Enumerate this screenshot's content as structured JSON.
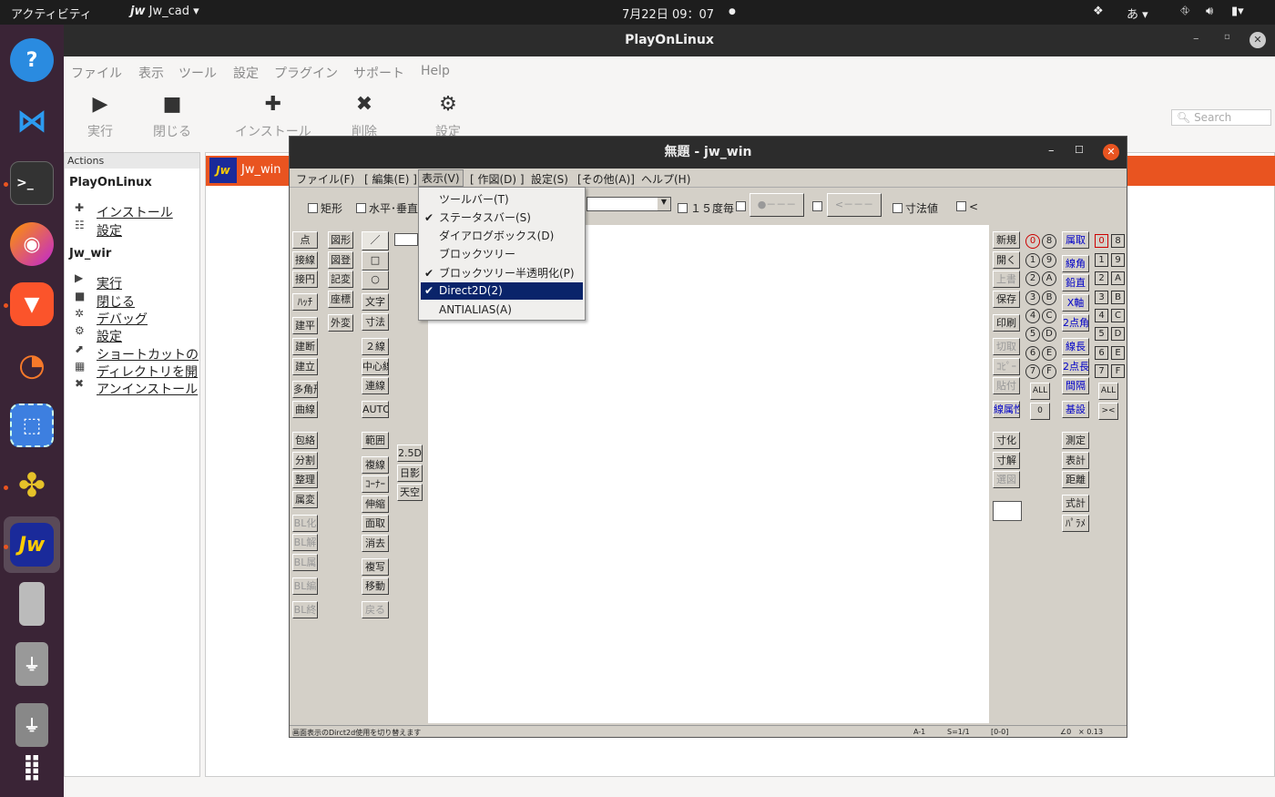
{
  "topbar": {
    "activities": "アクティビティ",
    "app": "Jw_cad",
    "clock": "7月22日  09：07",
    "ime": "あ"
  },
  "pol": {
    "title": "PlayOnLinux",
    "menu": [
      "ファイル",
      "表示",
      "ツール",
      "設定",
      "プラグイン",
      "サポート",
      "Help"
    ],
    "toolbar": {
      "run": "実行",
      "close": "閉じる",
      "install": "インストール",
      "remove": "削除",
      "settings": "設定"
    },
    "search_placeholder": "Search",
    "actions_header": "Actions",
    "section1": "PlayOnLinux",
    "s1_items": [
      "インストール",
      "設定"
    ],
    "section2": "Jw_wir",
    "s2_items": [
      "実行",
      "閉じる",
      "デバッグ",
      "設定",
      "ショートカットの",
      "ディレクトリを開",
      "アンインストール"
    ],
    "app_label": "Jw_win"
  },
  "jw": {
    "title": "無題 - jw_win",
    "menu": [
      "ファイル(F)",
      "[ 編集(E) ]",
      "表示(V)",
      "[ 作図(D) ]",
      "設定(S)",
      "[その他(A)]",
      "ヘルプ(H)"
    ],
    "opts": {
      "rect": "矩形",
      "hv": "水平･垂直",
      "deg": "１５度毎",
      "dim": "寸法値",
      "lt": "<"
    },
    "left1": [
      "点",
      "接線",
      "接円",
      "ﾊｯﾁ",
      "建平",
      "建断",
      "建立",
      "多角形",
      "曲線",
      "包絡",
      "分割",
      "整理",
      "属変",
      "BL化",
      "BL解",
      "BL属",
      "BL編",
      "BL終"
    ],
    "left2": [
      "図形",
      "図登",
      "記変",
      "座標",
      "外変"
    ],
    "left3": [
      "文字",
      "寸法",
      "２線",
      "中心線",
      "連線",
      "AUTO",
      "範囲",
      "複線",
      "ｺｰﾅｰ",
      "伸縮",
      "面取",
      "消去",
      "複写",
      "移動",
      "戻る"
    ],
    "left4": [
      "2.5D",
      "日影",
      "天空"
    ],
    "right1": [
      "新規",
      "開く",
      "上書",
      "保存",
      "印刷",
      "切取",
      "ｺﾋﾟｰ",
      "貼付",
      "線属性",
      "寸化",
      "寸解",
      "選図"
    ],
    "right_circ": [
      "0",
      "8",
      "1",
      "9",
      "2",
      "A",
      "3",
      "B",
      "4",
      "C",
      "5",
      "D",
      "6",
      "E",
      "7",
      "F"
    ],
    "right_circ_all": [
      "ALL",
      "0"
    ],
    "right2": [
      "属取",
      "線角",
      "鉛直",
      "X軸",
      "2点角",
      "線長",
      "2点長",
      "間隔",
      "基設",
      "測定",
      "表計",
      "距離",
      "式計",
      "ﾊﾟﾗﾒ"
    ],
    "right_sq": [
      "0",
      "8",
      "1",
      "9",
      "2",
      "A",
      "3",
      "B",
      "4",
      "C",
      "5",
      "D",
      "6",
      "E",
      "7",
      "F"
    ],
    "right_sq_all": [
      "ALL",
      "><"
    ],
    "status": {
      "msg": "画面表示のDirct2d使用を切り替えます",
      "a": "A-1",
      "s": "S=1/1",
      "b": "[0-0]",
      "ang": "∠0",
      "zoom": "× 0.13"
    }
  },
  "dropdown": [
    {
      "label": "ツールバー(T)",
      "checked": false
    },
    {
      "label": "ステータスバー(S)",
      "checked": true
    },
    {
      "label": "ダイアログボックス(D)",
      "checked": false
    },
    {
      "label": "ブロックツリー",
      "checked": false
    },
    {
      "label": "ブロックツリー半透明化(P)",
      "checked": true
    },
    {
      "label": "Direct2D(2)",
      "checked": true,
      "selected": true
    },
    {
      "label": "ANTIALIAS(A)",
      "checked": false
    }
  ]
}
